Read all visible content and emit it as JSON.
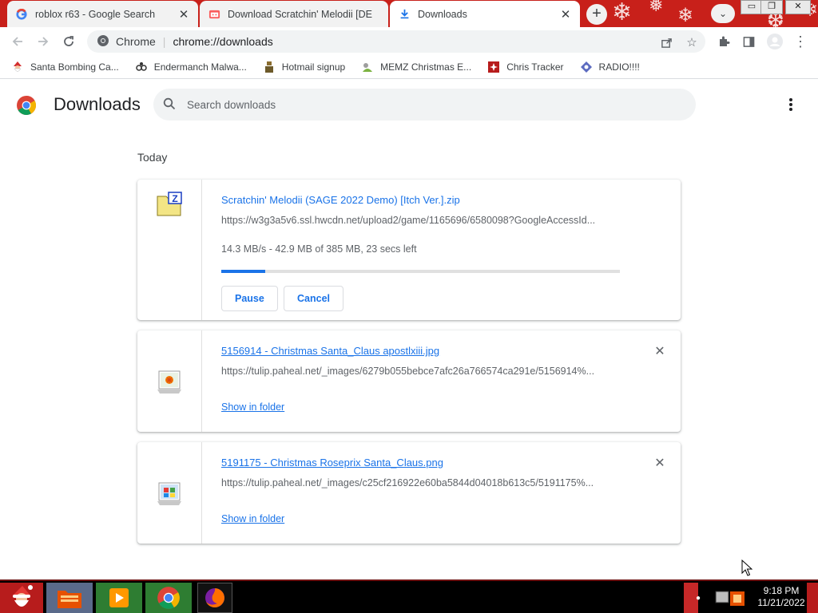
{
  "tabs": [
    {
      "title": "roblox r63 - Google Search",
      "favicon": "google-favicon",
      "active": false
    },
    {
      "title": "Download Scratchin' Melodii [DE",
      "favicon": "itch-favicon",
      "active": false
    },
    {
      "title": "Downloads",
      "favicon": "download-favicon",
      "active": true
    }
  ],
  "window_controls": {
    "minimize": "▭",
    "restore": "❐",
    "close": "✕"
  },
  "omnibox": {
    "site_label": "Chrome",
    "url": "chrome://downloads"
  },
  "bookmarks": [
    {
      "label": "Santa Bombing Ca...",
      "icon": "santa-icon"
    },
    {
      "label": "Endermanch Malwa...",
      "icon": "glasses-icon"
    },
    {
      "label": "Hotmail signup",
      "icon": "person-icon"
    },
    {
      "label": "MEMZ Christmas E...",
      "icon": "memz-icon"
    },
    {
      "label": "Chris Tracker",
      "icon": "tracker-icon"
    },
    {
      "label": "RADIO!!!!",
      "icon": "radio-icon"
    }
  ],
  "page": {
    "title": "Downloads",
    "search_placeholder": "Search downloads",
    "section_label": "Today"
  },
  "downloads": [
    {
      "filename": "Scratchin' Melodii (SAGE 2022 Demo) [Itch Ver.].zip",
      "url": "https://w3g3a5v6.ssl.hwcdn.net/upload2/game/1165696/6580098?GoogleAccessId...",
      "status": "14.3 MB/s - 42.9 MB of 385 MB, 23 secs left",
      "progress": 0.111,
      "pause_label": "Pause",
      "cancel_label": "Cancel",
      "icon": "zip-file-icon"
    },
    {
      "filename": "5156914 - Christmas Santa_Claus apostlxiii.jpg",
      "url": "https://tulip.paheal.net/_images/6279b055bebce7afc26a766574ca291e/5156914%...",
      "show_folder_label": "Show in folder",
      "icon": "image-file-icon"
    },
    {
      "filename": "5191175 - Christmas Roseprix Santa_Claus.png",
      "url": "https://tulip.paheal.net/_images/c25cf216922e60ba5844d04018b613c5/5191175%...",
      "show_folder_label": "Show in folder",
      "icon": "image-file-icon"
    }
  ],
  "taskbar": {
    "items": [
      "start-santa-icon",
      "file-manager-icon",
      "media-player-icon",
      "chrome-icon",
      "firefox-icon"
    ],
    "time": "9:18 PM",
    "date": "11/21/2022"
  },
  "colors": {
    "tabstrip": "#c8201a",
    "accent": "#1a73e8",
    "taskbar": "#000000"
  }
}
